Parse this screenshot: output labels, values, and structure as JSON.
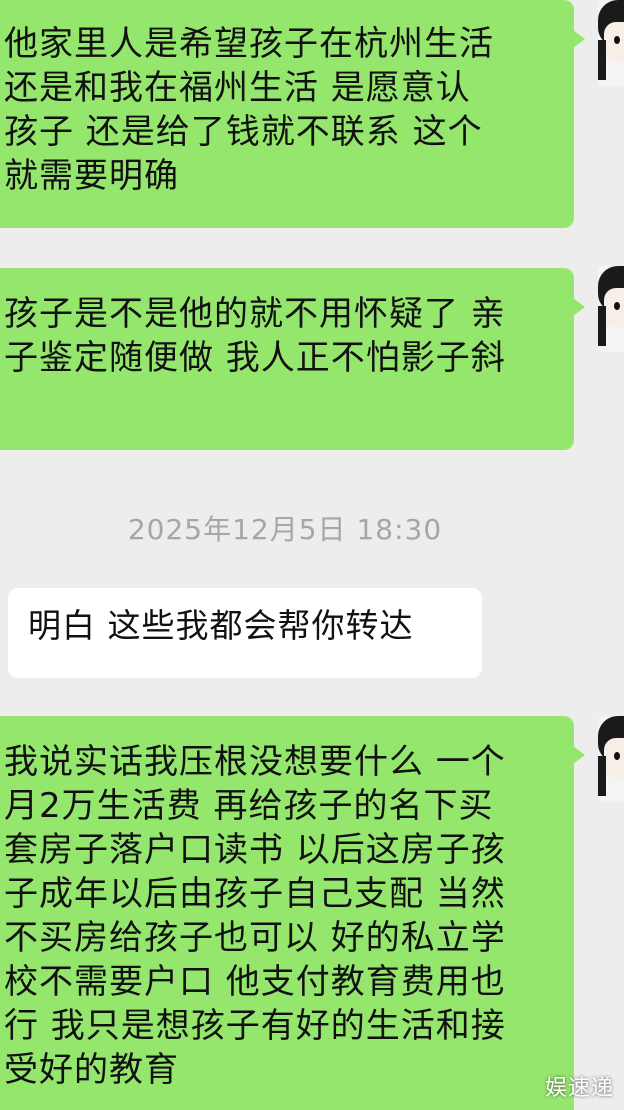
{
  "messages": [
    {
      "side": "outgoing",
      "lines": [
        "他家里人是希望孩子在杭州生活",
        "还是和我在福州生活  是愿意认",
        "孩子  还是给了钱就不联系  这个",
        "就需要明确"
      ]
    },
    {
      "side": "outgoing",
      "lines": [
        "孩子是不是他的就不用怀疑了  亲",
        "子鉴定随便做  我人正不怕影子斜"
      ]
    },
    {
      "side": "incoming",
      "lines": [
        "明白  这些我都会帮你转达"
      ]
    },
    {
      "side": "outgoing",
      "lines": [
        "我说实话我压根没想要什么  一个",
        "月2万生活费  再给孩子的名下买",
        "套房子落户口读书  以后这房子孩",
        "子成年以后由孩子自己支配  当然",
        "不买房给孩子也可以  好的私立学",
        "校不需要户口  他支付教育费用也",
        "行  我只是想孩子有好的生活和接",
        "受好的教育"
      ]
    }
  ],
  "timestamp": "2025年12月5日 18:30",
  "watermark": "娱速递",
  "colors": {
    "background": "#ededed",
    "outgoing_bubble": "#95e66d",
    "incoming_bubble": "#ffffff",
    "timestamp_text": "#a6a6a6"
  },
  "icons": [
    "avatar"
  ]
}
